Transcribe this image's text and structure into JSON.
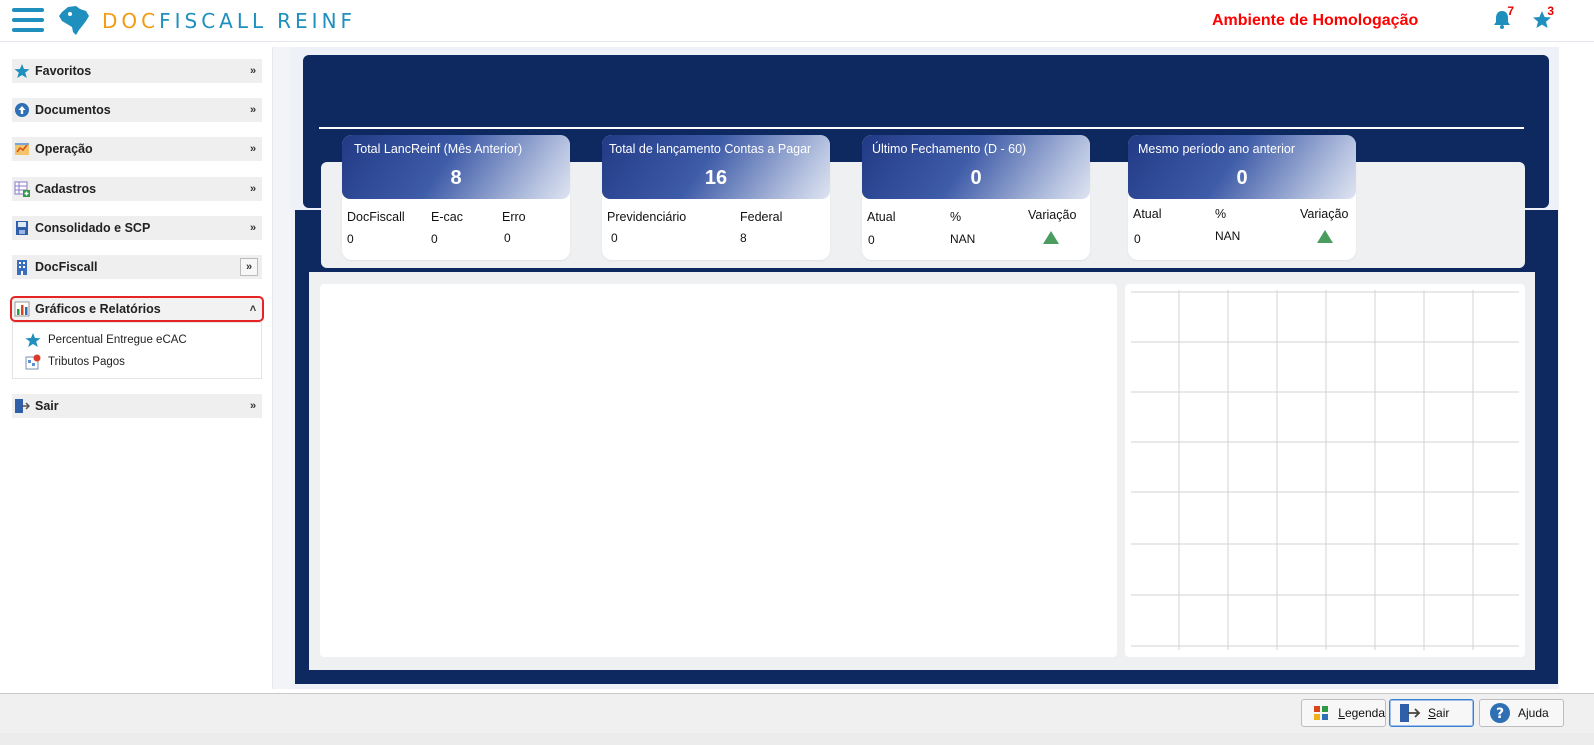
{
  "header": {
    "brand_doc": "DOC",
    "brand_fiscall": "FISCALL",
    "brand_reinf": "REINF",
    "environment": "Ambiente de Homologação",
    "notifications_count": "7",
    "favorites_count": "3"
  },
  "sidebar": {
    "items": [
      {
        "label": "Favoritos",
        "icon": "star-icon"
      },
      {
        "label": "Documentos",
        "icon": "upload-circle-icon"
      },
      {
        "label": "Operação",
        "icon": "operation-icon"
      },
      {
        "label": "Cadastros",
        "icon": "table-add-icon"
      },
      {
        "label": "Consolidado e SCP",
        "icon": "save-icon"
      },
      {
        "label": "DocFiscall",
        "icon": "building-icon"
      },
      {
        "label": "Gráficos e Relatórios",
        "icon": "bar-chart-icon"
      },
      {
        "label": "Sair",
        "icon": "exit-icon"
      }
    ],
    "submenu": [
      {
        "label": "Percentual Entregue eCAC",
        "icon": "star-icon"
      },
      {
        "label": "Tributos Pagos",
        "icon": "report-icon"
      }
    ]
  },
  "cards": [
    {
      "title": "Total LancReinf (Mês Anterior)",
      "value": "8",
      "cols": [
        "DocFiscall",
        "E-cac",
        "Erro"
      ],
      "vals": [
        "0",
        "0",
        "0"
      ]
    },
    {
      "title": "Total de lançamento Contas a Pagar",
      "value": "16",
      "cols": [
        "Previdenciário",
        "Federal"
      ],
      "vals": [
        "0",
        "8"
      ]
    },
    {
      "title": "Último Fechamento  (D - 60)",
      "value": "0",
      "cols": [
        "Atual",
        "%",
        "Variação"
      ],
      "vals": [
        "0",
        "NAN"
      ]
    },
    {
      "title": "Mesmo período ano anterior",
      "value": "0",
      "cols": [
        "Atual",
        "%",
        "Variação"
      ],
      "vals": [
        "0",
        "NAN"
      ]
    }
  ],
  "footer": {
    "legend_label": "egenda",
    "legend_mnemonic": "L",
    "exit_label": "air",
    "exit_mnemonic": "S",
    "help_label": "Ajuda"
  },
  "colors": {
    "navy": "#0d2960",
    "accent_blue": "#1f8fbd",
    "brand_orange": "#f39c12",
    "env_red": "#ff0000",
    "up_green": "#4a9d5f"
  }
}
